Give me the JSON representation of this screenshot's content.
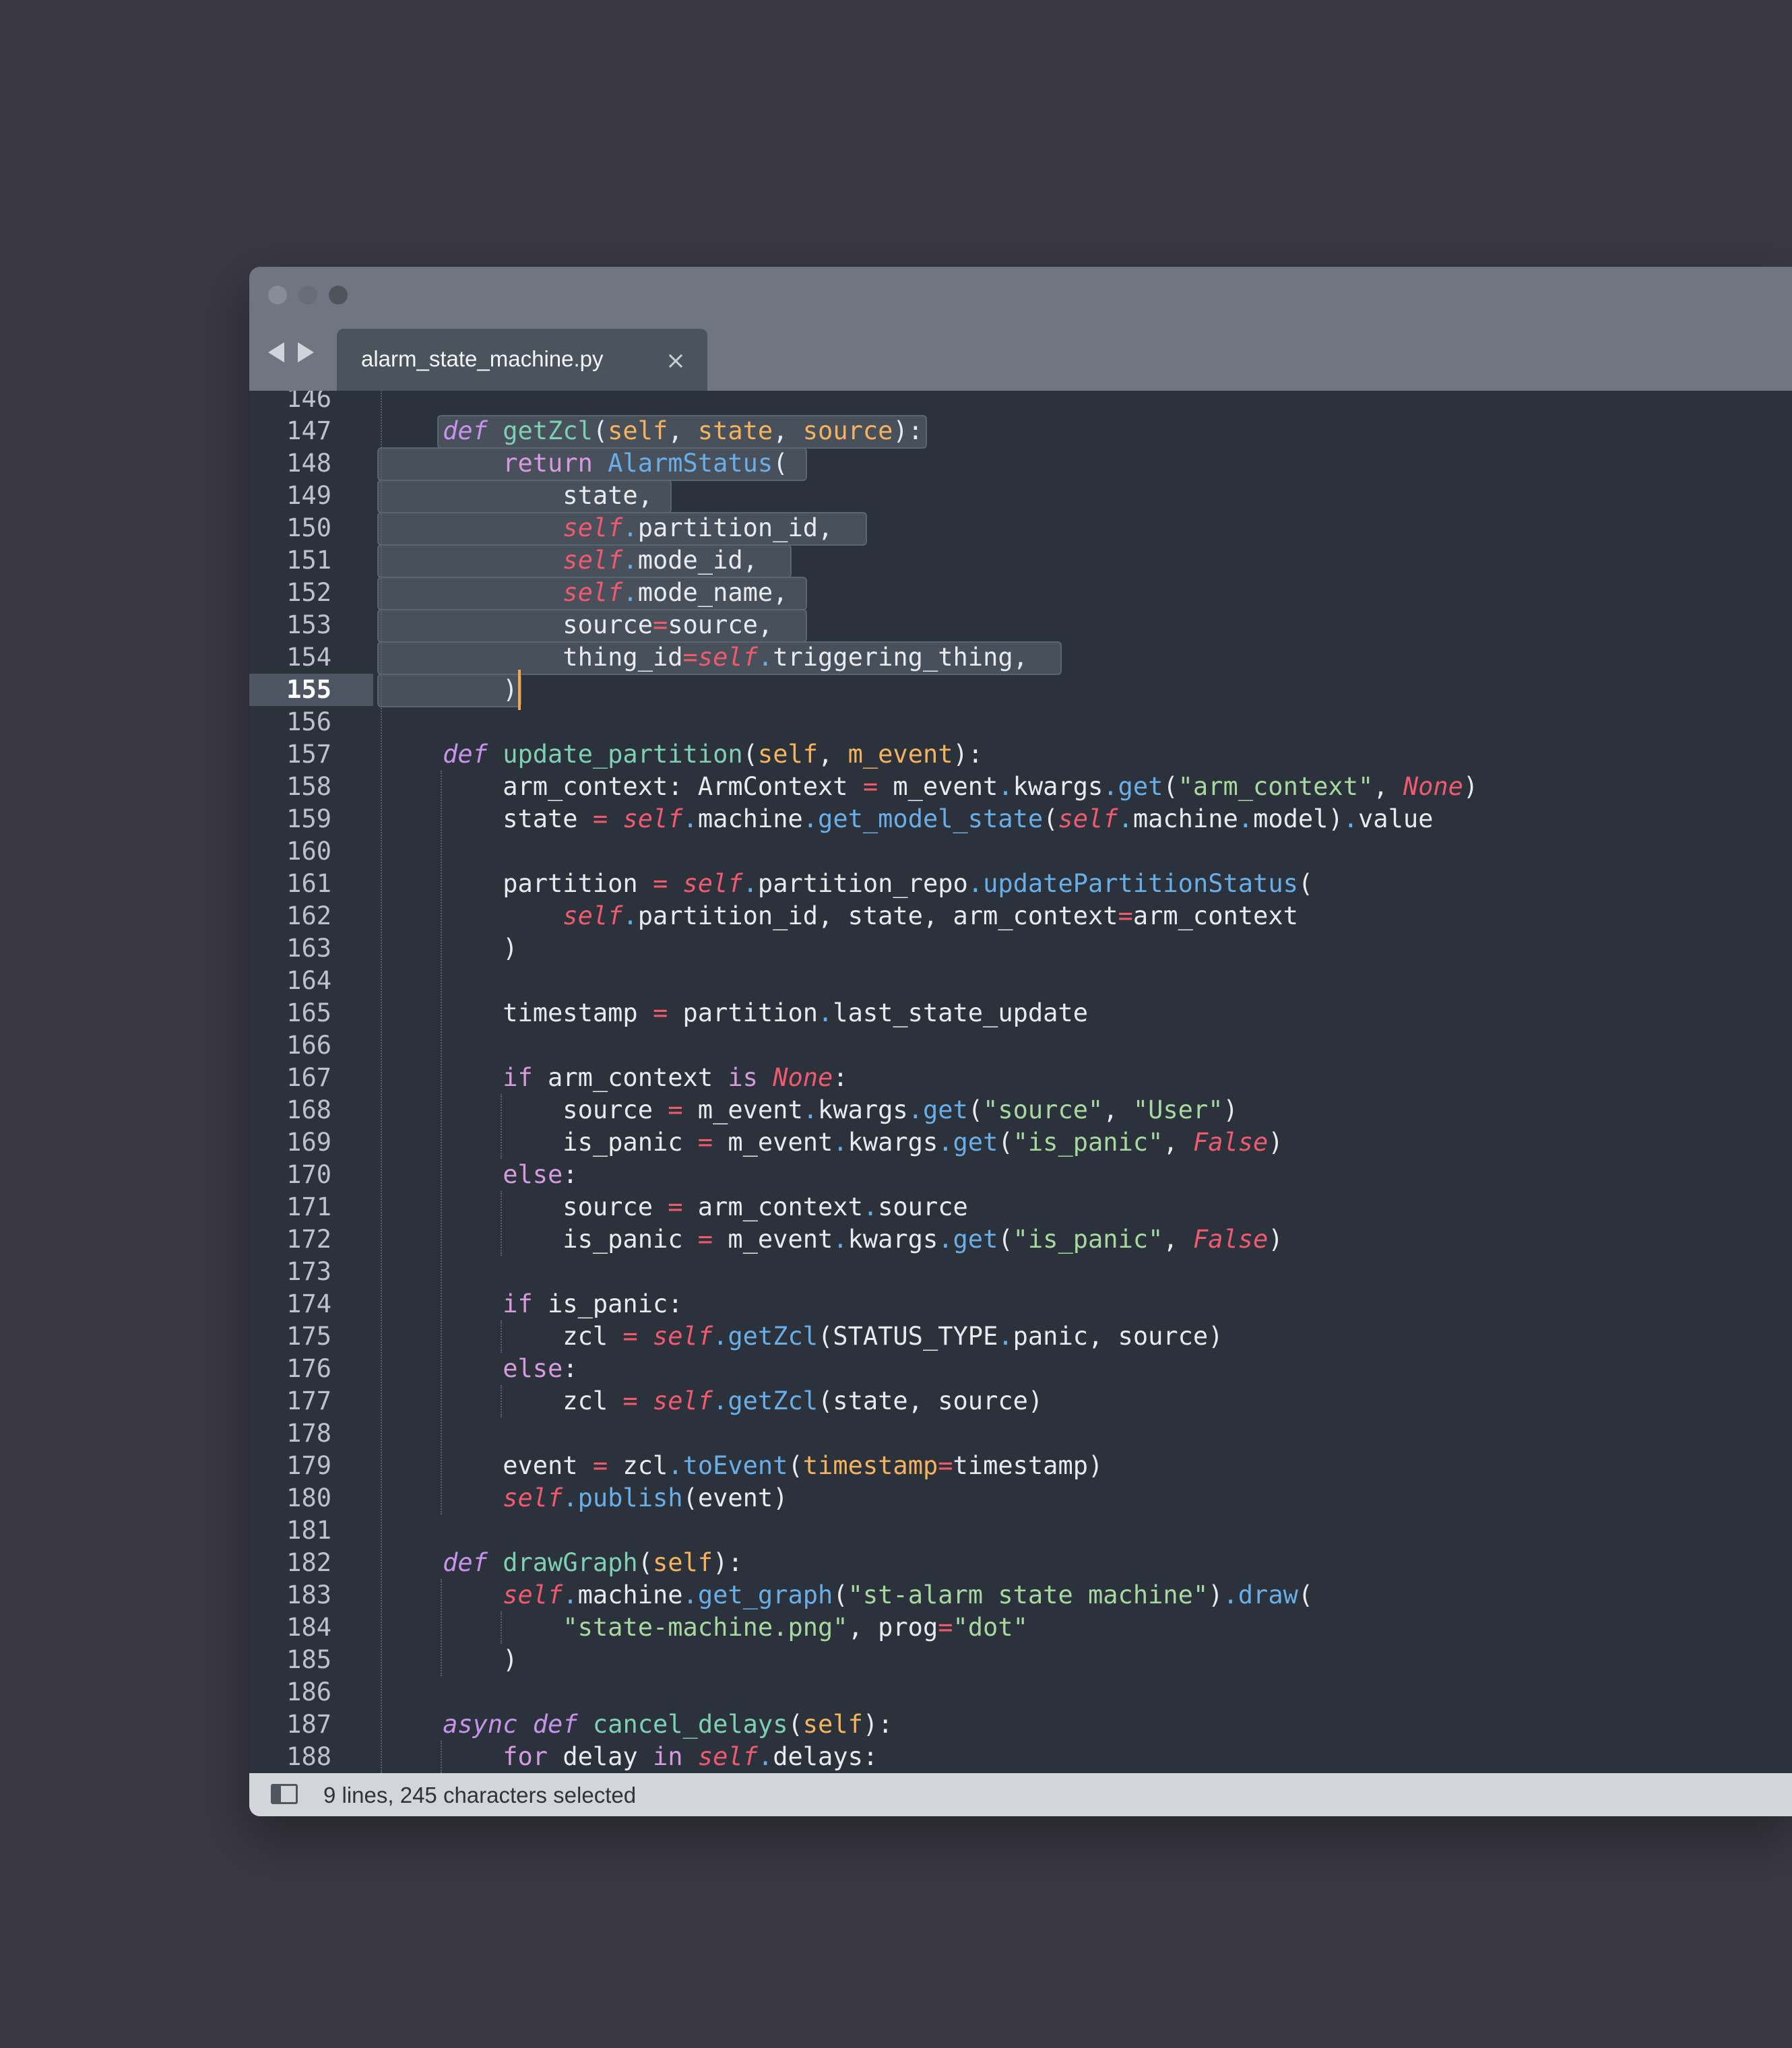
{
  "tab": {
    "title": "alarm_state_machine.py",
    "close": "×"
  },
  "status": {
    "text": "9 lines, 245 characters selected"
  },
  "colors": {
    "keyword": "#d79adf",
    "function": "#7fcfb2",
    "param": "#f4b35c",
    "self": "#ef5a6e",
    "method": "#6aaee8",
    "string": "#a6d8a0",
    "cursor": "#f3a74a"
  },
  "line_numbers": [
    "146",
    "147",
    "148",
    "149",
    "150",
    "151",
    "152",
    "153",
    "154",
    "155",
    "156",
    "157",
    "158",
    "159",
    "160",
    "161",
    "162",
    "163",
    "164",
    "165",
    "166",
    "167",
    "168",
    "169",
    "170",
    "171",
    "172",
    "173",
    "174",
    "175",
    "176",
    "177",
    "178",
    "179",
    "180",
    "181",
    "182",
    "183",
    "184",
    "185",
    "186",
    "187",
    "188"
  ],
  "current_line": "155",
  "code_lines": [
    "",
    "    def getZcl(self, state, source):",
    "        return AlarmStatus(",
    "            state,",
    "            self.partition_id,",
    "            self.mode_id,",
    "            self.mode_name,",
    "            source=source,",
    "            thing_id=self.triggering_thing,",
    "        )",
    "",
    "    def update_partition(self, m_event):",
    "        arm_context: ArmContext = m_event.kwargs.get(\"arm_context\", None)",
    "        state = self.machine.get_model_state(self.machine.model).value",
    "",
    "        partition = self.partition_repo.updatePartitionStatus(",
    "            self.partition_id, state, arm_context=arm_context",
    "        )",
    "",
    "        timestamp = partition.last_state_update",
    "",
    "        if arm_context is None:",
    "            source = m_event.kwargs.get(\"source\", \"User\")",
    "            is_panic = m_event.kwargs.get(\"is_panic\", False)",
    "        else:",
    "            source = arm_context.source",
    "            is_panic = m_event.kwargs.get(\"is_panic\", False)",
    "",
    "        if is_panic:",
    "            zcl = self.getZcl(STATUS_TYPE.panic, source)",
    "        else:",
    "            zcl = self.getZcl(state, source)",
    "",
    "        event = zcl.toEvent(timestamp=timestamp)",
    "        self.publish(event)",
    "",
    "    def drawGraph(self):",
    "        self.machine.get_graph(\"st-alarm state machine\").draw(",
    "            \"state-machine.png\", prog=\"dot\"",
    "        )",
    "",
    "    async def cancel_delays(self):",
    "        for delay in self.delays:"
  ]
}
